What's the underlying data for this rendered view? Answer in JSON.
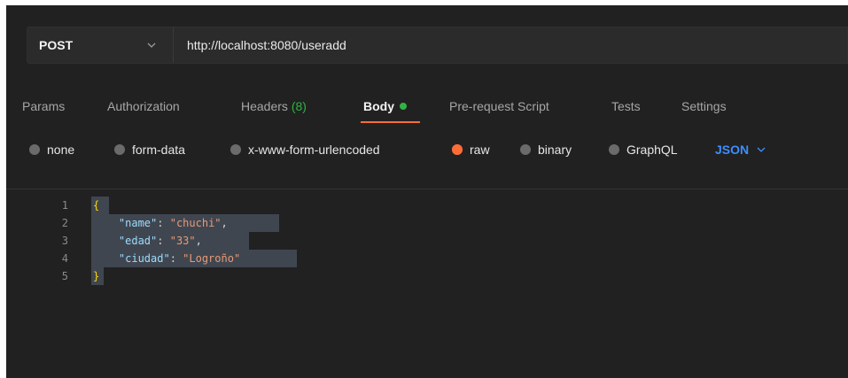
{
  "request": {
    "method": "POST",
    "url": "http://localhost:8080/useradd"
  },
  "tabs": [
    {
      "label": "Params"
    },
    {
      "label": "Authorization"
    },
    {
      "label": "Headers",
      "count": "(8)"
    },
    {
      "label": "Body"
    },
    {
      "label": "Pre-request Script"
    },
    {
      "label": "Tests"
    },
    {
      "label": "Settings"
    }
  ],
  "active_tab": "Body",
  "body_types": [
    {
      "label": "none"
    },
    {
      "label": "form-data"
    },
    {
      "label": "x-www-form-urlencoded"
    },
    {
      "label": "raw"
    },
    {
      "label": "binary"
    },
    {
      "label": "GraphQL"
    }
  ],
  "selected_body_type": "raw",
  "format": "JSON",
  "editor": {
    "lines": [
      {
        "num": "1",
        "text": "{"
      },
      {
        "num": "2",
        "key": "\"name\"",
        "value": "\"chuchi\"",
        "trail": ","
      },
      {
        "num": "3",
        "key": "\"edad\"",
        "value": "\"33\"",
        "trail": ","
      },
      {
        "num": "4",
        "key": "\"ciudad\"",
        "value": "\"Logroño\"",
        "trail": ""
      },
      {
        "num": "5",
        "text": "}"
      }
    ]
  },
  "colors": {
    "accent": "#ff6c37",
    "json_link": "#3d8eff",
    "body_dot": "#2fb344"
  }
}
